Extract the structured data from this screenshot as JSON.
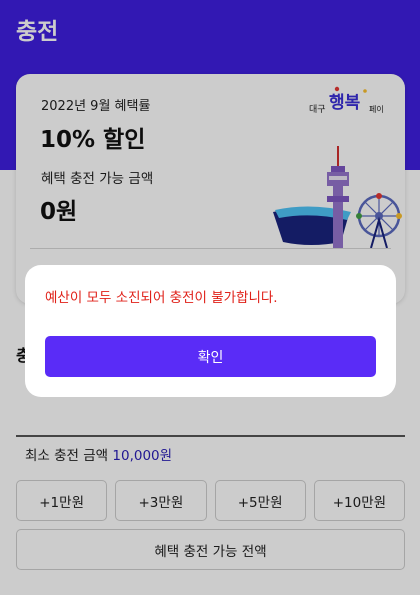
{
  "header": {
    "title": "충전"
  },
  "benefit_card": {
    "period_label": "2022년 9월 혜택률",
    "rate_value": "10% 할인",
    "available_label": "혜택 충전 가능 금액",
    "available_value": "0원",
    "brand_logo": {
      "text_left": "대구",
      "text_main": "행복",
      "text_right": "페이"
    }
  },
  "charge": {
    "section_title": "충",
    "min_label": "최소 충전 금액",
    "min_value": "10,000원",
    "quick_buttons": [
      "+1만원",
      "+3만원",
      "+5만원",
      "+10만원"
    ],
    "full_button_label": "혜택 충전 가능 전액"
  },
  "alert": {
    "message": "예산이 모두 소진되어 충전이 불가합니다.",
    "confirm_label": "확인"
  },
  "colors": {
    "header_bg": "#3f1fe0",
    "accent_button": "#5a2cf7",
    "alert_text": "#e0221a",
    "min_amount_text": "#2a1fb8"
  }
}
